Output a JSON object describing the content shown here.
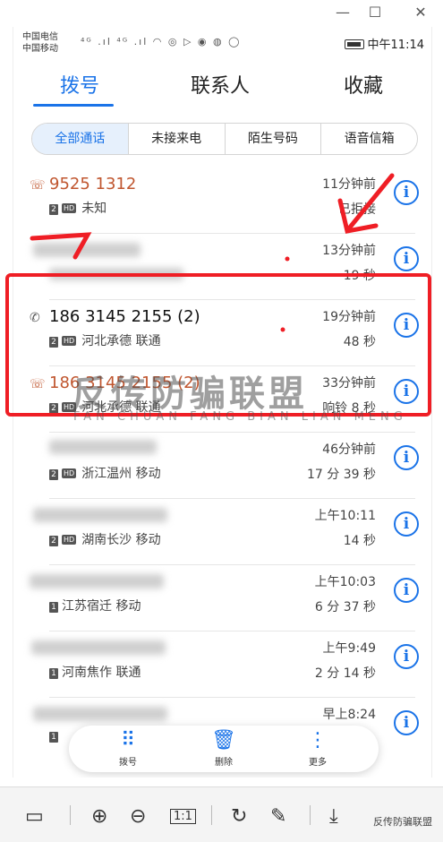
{
  "window_controls": {
    "minimize": "—",
    "maximize": "☐",
    "close": "✕"
  },
  "status_bar": {
    "carrier1": "中国电信",
    "carrier2": "中国移动",
    "signal_icons": "⁴ᴳ .ıl ⁴ᴳ .ıl ◠ ◎ ▷ ◉ ◍ ◯",
    "time": "中午11:14"
  },
  "tabs": [
    {
      "label": "拨号",
      "active": true
    },
    {
      "label": "联系人",
      "active": false
    },
    {
      "label": "收藏",
      "active": false
    }
  ],
  "filters": [
    {
      "label": "全部通话",
      "active": true
    },
    {
      "label": "未接来电",
      "active": false
    },
    {
      "label": "陌生号码",
      "active": false
    },
    {
      "label": "语音信箱",
      "active": false
    }
  ],
  "calls": [
    {
      "icon": "☏",
      "number": "9525 1312",
      "missed": true,
      "sim": "2",
      "location": "未知",
      "time": "11分钟前",
      "duration": "已拒接"
    },
    {
      "icon": "",
      "number": "",
      "missed": false,
      "sim": "",
      "location": "",
      "time": "13分钟前",
      "duration": "19 秒"
    },
    {
      "icon": "✆",
      "number": "186 3145 2155 (2)",
      "missed": false,
      "sim": "2",
      "location": "河北承德 联通",
      "time": "19分钟前",
      "duration": "48 秒"
    },
    {
      "icon": "☏",
      "number": "186 3145 2155 (2)",
      "missed": true,
      "sim": "2",
      "location": "河北承德 联通",
      "time": "33分钟前",
      "duration": "响铃 8 秒"
    },
    {
      "icon": "",
      "number": "",
      "missed": false,
      "sim": "2",
      "location": "浙江温州 移动",
      "time": "46分钟前",
      "duration": "17 分 39 秒"
    },
    {
      "icon": "",
      "number": "",
      "missed": false,
      "sim": "2",
      "location": "湖南长沙 移动",
      "time": "上午10:11",
      "duration": "14 秒"
    },
    {
      "icon": "",
      "number": "",
      "missed": false,
      "sim": "1",
      "location": "江苏宿迁 移动",
      "time": "上午10:03",
      "duration": "6 分 37 秒"
    },
    {
      "icon": "",
      "number": "",
      "missed": false,
      "sim": "1",
      "location": "河南焦作 联通",
      "time": "上午9:49",
      "duration": "2 分 14 秒"
    },
    {
      "icon": "",
      "number": "",
      "missed": false,
      "sim": "1",
      "location": "",
      "time": "早上8:24",
      "duration": ""
    }
  ],
  "hd_label": "HD",
  "info_glyph": "i",
  "bottom_bar": [
    {
      "icon": "⠿",
      "label": "拨号"
    },
    {
      "icon": "🗑",
      "label": "删除"
    },
    {
      "icon": "⋮",
      "label": "更多"
    }
  ],
  "watermark": {
    "main": "反传防骗联盟",
    "sub": "FAN CHUAN FANG BIAN LIAN MENG"
  },
  "viewer_toolbar": {
    "fit": "▭",
    "zoom_in": "⊕",
    "zoom_out": "⊖",
    "actual_size": "1:1",
    "rotate": "↻",
    "edit": "✎",
    "download": "⤓"
  },
  "wechat_tag": "反传防骗联盟",
  "colors": {
    "accent": "#1a73e8",
    "missed": "#c0562f",
    "annotation": "#ef1e25"
  }
}
